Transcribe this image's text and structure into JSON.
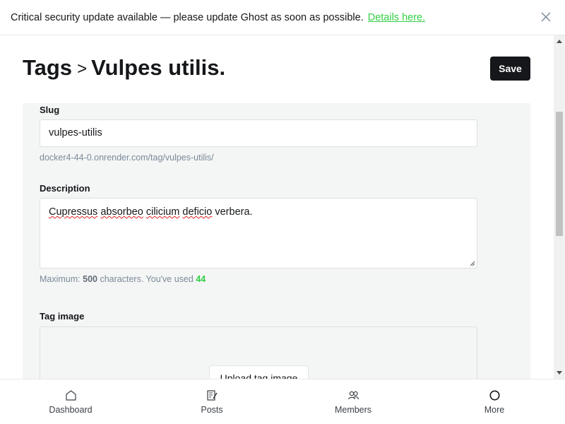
{
  "banner": {
    "text": "Critical security update available — please update Ghost as soon as possible.",
    "link": "Details here."
  },
  "header": {
    "breadcrumb": "Tags",
    "separator": ">",
    "title": "Vulpes utilis.",
    "save_label": "Save"
  },
  "form": {
    "slug": {
      "label": "Slug",
      "value": "vulpes-utilis",
      "url_hint": "docker4-44-0.onrender.com/tag/vulpes-utilis/"
    },
    "description": {
      "label": "Description",
      "words": [
        "Cupressus",
        "absorbeo",
        "cilicium",
        "deficio",
        "verbera."
      ],
      "hint_prefix": "Maximum:",
      "max": "500",
      "hint_middle": "characters. You've used",
      "used": "44"
    },
    "tag_image": {
      "label": "Tag image",
      "upload_label": "Upload tag image"
    }
  },
  "bottom_nav": {
    "items": [
      {
        "label": "Dashboard",
        "icon": "home-icon"
      },
      {
        "label": "Posts",
        "icon": "posts-icon"
      },
      {
        "label": "Members",
        "icon": "members-icon"
      },
      {
        "label": "More",
        "icon": "more-circle-icon"
      }
    ]
  },
  "colors": {
    "accent_green": "#30cf43",
    "primary_button": "#15171a",
    "panel_bg": "#f4f5f5"
  }
}
